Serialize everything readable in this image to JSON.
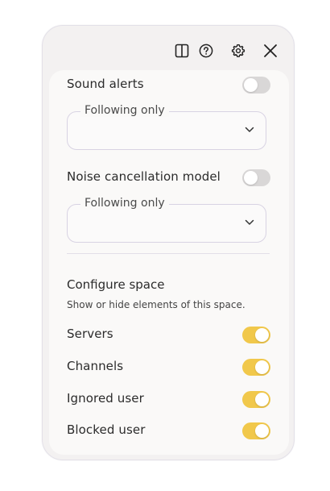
{
  "toolbar": {
    "buttons": [
      "panel-icon",
      "help-icon",
      "gear-icon",
      "close-icon"
    ]
  },
  "notifications": {
    "sound_alerts": {
      "label": "Sound alerts",
      "enabled": false
    },
    "sound_alerts_select": {
      "legend": "Following only",
      "value": ""
    },
    "noise_cancellation": {
      "label": "Noise cancellation model",
      "enabled": false
    },
    "noise_cancellation_select": {
      "legend": "Following only",
      "value": ""
    }
  },
  "configure_space": {
    "title": "Configure space",
    "subtitle": "Show or hide elements of this space.",
    "items": [
      {
        "label": "Servers",
        "enabled": true
      },
      {
        "label": "Channels",
        "enabled": true
      },
      {
        "label": "Ignored user",
        "enabled": true
      },
      {
        "label": "Blocked user",
        "enabled": true
      }
    ]
  },
  "colors": {
    "toggle_on": "#f1c84b",
    "toggle_off": "#d9d7d7",
    "panel_bg": "#f3f1f1",
    "card_bg": "#faf9f8"
  }
}
